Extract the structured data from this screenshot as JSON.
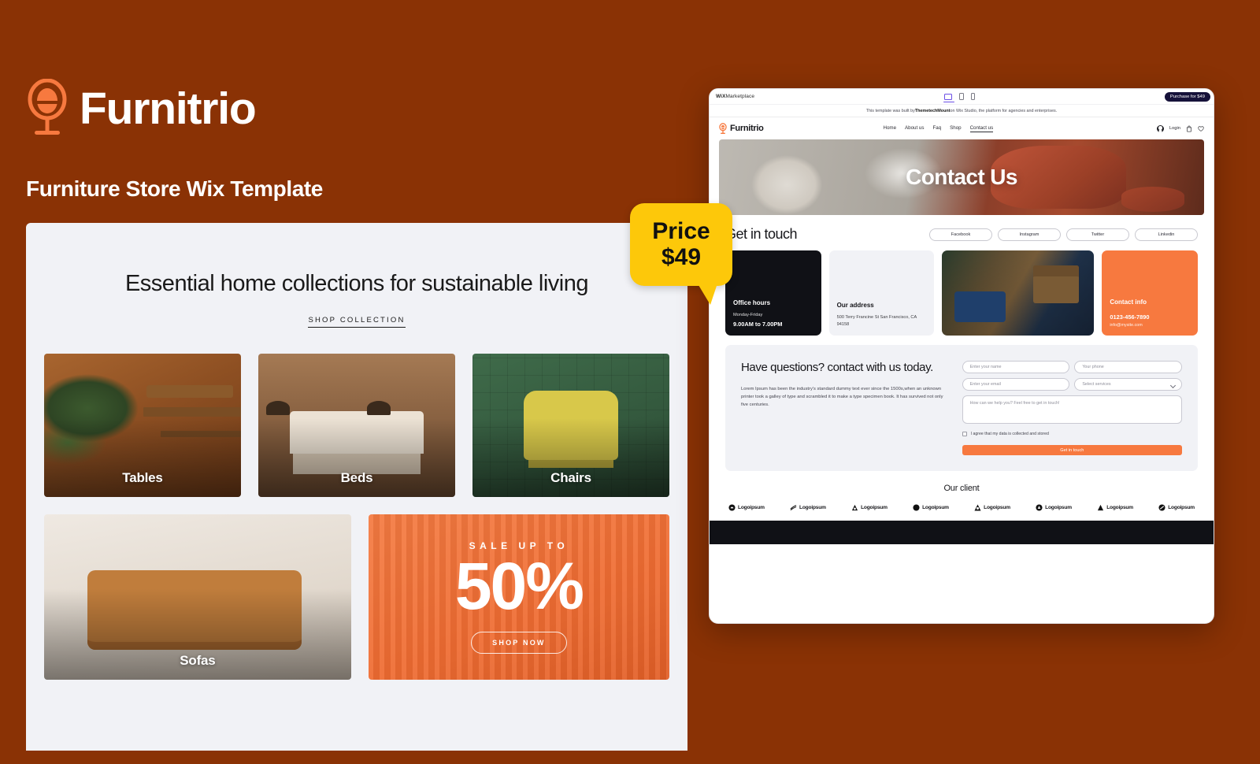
{
  "brand": {
    "name": "Furnitrio",
    "subtitle": "Furniture Store Wix Template",
    "logo_icon": "chair-lamp-logo-icon",
    "bg_color": "#8a3205",
    "accent_color": "#f7793f"
  },
  "price_badge": {
    "line1": "Price",
    "line2": "$49",
    "color": "#fdc80a"
  },
  "preview": {
    "heading": "Essential home collections for sustainable living",
    "cta": "SHOP COLLECTION",
    "categories": [
      {
        "label": "Tables"
      },
      {
        "label": "Beds"
      },
      {
        "label": "Chairs"
      },
      {
        "label": "Sofas"
      }
    ],
    "sale": {
      "kicker": "SALE UP TO",
      "percent": "50%",
      "button": "SHOP NOW"
    }
  },
  "mock": {
    "topbar": {
      "marketplace_bold": "WiX",
      "marketplace_rest": "Marketplace",
      "devices": [
        "desktop-icon",
        "tablet-icon",
        "phone-icon"
      ],
      "purchase_label": "Purchase for $49"
    },
    "notice": {
      "prefix": "This template was built by ",
      "author": "ThemetechMount",
      "suffix": " on Wix Studio, the platform for agencies and enterprises."
    },
    "nav": {
      "logo_text": "Furnitrio",
      "links": [
        "Home",
        "About us",
        "Faq",
        "Shop",
        "Contact us"
      ],
      "active_link": "Contact us",
      "login_label": "Login",
      "icons": [
        "account-icon",
        "cart-icon",
        "heart-icon"
      ]
    },
    "hero": {
      "title": "Contact Us"
    },
    "get_in_touch": {
      "title": "Get in touch",
      "socials": [
        "Facebook",
        "Instagram",
        "Twitter",
        "Linkedin"
      ]
    },
    "info_cards": {
      "office": {
        "title": "Office hours",
        "days": "Monday-Friday",
        "hours": "9.00AM to 7.00PM"
      },
      "address": {
        "title": "Our address",
        "line": "500 Terry Francine St San Francisco, CA 94158"
      },
      "photo_alt": "showroom-photo",
      "contact": {
        "title": "Contact info",
        "phone": "0123-456-7890",
        "email": "info@mysite.com"
      }
    },
    "form": {
      "title": "Have questions? contact with us today.",
      "body": "Lorem Ipsum has been the industry's standard dummy text ever since the 1500s,when an unknown printer took a galley of type and scrambled it to make a type specimen book. It has survived not only five centuries.",
      "name_placeholder": "Enter your name",
      "phone_placeholder": "Your phone",
      "email_placeholder": "Enter your email",
      "services_placeholder": "Select services",
      "message_placeholder": "How can we help you? Feel free to get  in touch!",
      "consent_label": "I agree that my data is collected and stored",
      "submit_label": "Get in touch"
    },
    "clients": {
      "title": "Our client",
      "logos": [
        {
          "name": "Logoipsum",
          "mark": "logo-mark-1"
        },
        {
          "name": "Logoipsum",
          "mark": "logo-mark-2"
        },
        {
          "name": "Logoipsum",
          "mark": "logo-mark-3"
        },
        {
          "name": "Logoipsum",
          "mark": "logo-mark-4"
        },
        {
          "name": "Logoipsum",
          "mark": "logo-mark-5"
        },
        {
          "name": "Logoipsum",
          "mark": "logo-mark-6"
        },
        {
          "name": "Logoipsum",
          "mark": "logo-mark-7"
        },
        {
          "name": "Logoipsum",
          "mark": "logo-mark-8"
        }
      ]
    }
  }
}
